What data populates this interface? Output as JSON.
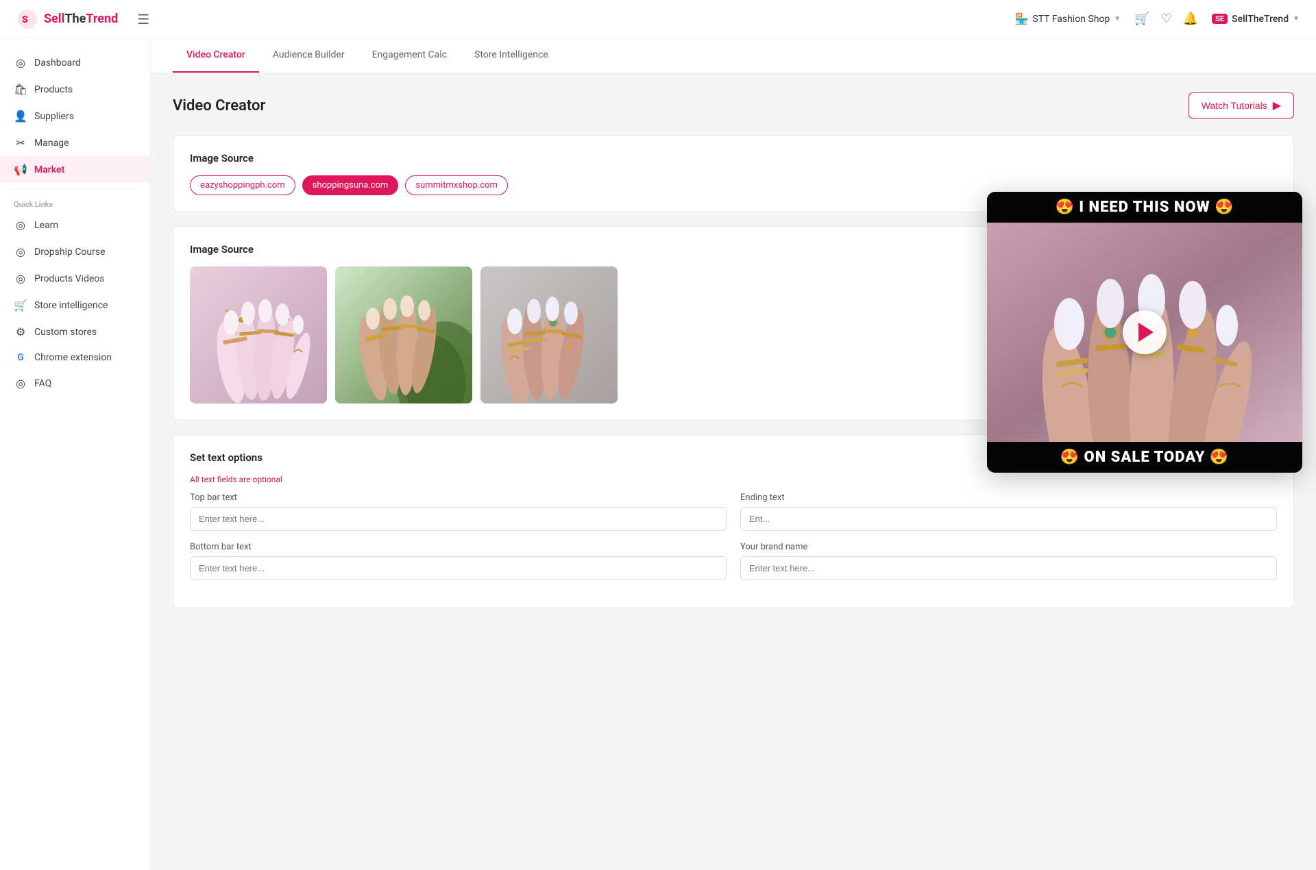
{
  "topbar": {
    "logo_text_sell": "Sell",
    "logo_text_the": "The",
    "logo_text_trend": "Trend",
    "store_label": "STT Fashion Shop",
    "user_badge": "SE",
    "user_name": "SellTheTrend",
    "hamburger_icon": "☰"
  },
  "sidebar": {
    "items": [
      {
        "id": "dashboard",
        "label": "Dashboard",
        "icon": "◎"
      },
      {
        "id": "products",
        "label": "Products",
        "icon": "🛍"
      },
      {
        "id": "suppliers",
        "label": "Suppliers",
        "icon": "👤"
      },
      {
        "id": "manage",
        "label": "Manage",
        "icon": "✂"
      },
      {
        "id": "market",
        "label": "Market",
        "icon": "📢",
        "active": true
      }
    ],
    "quick_links_label": "Quick Links",
    "quick_links": [
      {
        "id": "learn",
        "label": "Learn",
        "icon": "◎"
      },
      {
        "id": "dropship-course",
        "label": "Dropship Course",
        "icon": "◎"
      },
      {
        "id": "products-videos",
        "label": "Products Videos",
        "icon": "◎"
      },
      {
        "id": "store-intelligence",
        "label": "Store intelligence",
        "icon": "🛒"
      },
      {
        "id": "custom-stores",
        "label": "Custom stores",
        "icon": "⚙"
      },
      {
        "id": "chrome-extension",
        "label": "Chrome extension",
        "icon": "G"
      },
      {
        "id": "faq",
        "label": "FAQ",
        "icon": "◎"
      }
    ]
  },
  "subnav": {
    "items": [
      {
        "id": "video-creator",
        "label": "Video Creator",
        "active": true
      },
      {
        "id": "audience-builder",
        "label": "Audience Builder"
      },
      {
        "id": "engagement-calc",
        "label": "Engagement Calc"
      },
      {
        "id": "store-intelligence",
        "label": "Store Intelligence"
      }
    ]
  },
  "page": {
    "title": "Video Creator",
    "watch_tutorials_btn": "Watch Tutorials"
  },
  "image_source_section1": {
    "title": "Image Source",
    "tags": [
      {
        "label": "eazyshoppingph.com",
        "active": false
      },
      {
        "label": "shoppingsuna.com",
        "active": true
      },
      {
        "label": "summitmxshop.com",
        "active": false
      }
    ]
  },
  "image_source_section2": {
    "title": "Image Source",
    "images": [
      {
        "alt": "Hand with multiple gold rings on white nails"
      },
      {
        "alt": "Hand with gold rings and star nail art on green plant background"
      },
      {
        "alt": "Hand with gold rings and white nails partial view"
      }
    ]
  },
  "text_options_section": {
    "title": "Set text options",
    "hint": "All text fields are optional",
    "fields": [
      {
        "id": "top-bar-text",
        "label": "Top bar text",
        "placeholder": "Enter text here..."
      },
      {
        "id": "ending-text",
        "label": "Ending text",
        "placeholder": "Ent..."
      }
    ],
    "fields2": [
      {
        "id": "bottom-bar-text",
        "label": "Bottom bar text",
        "placeholder": "Enter text here..."
      },
      {
        "id": "brand-name",
        "label": "Your brand name",
        "placeholder": "Enter text here..."
      }
    ]
  },
  "video_overlay": {
    "top_bar": "😍 I NEED THIS NOW 😍",
    "bottom_bar": "😍 ON SALE TODAY 😍"
  }
}
